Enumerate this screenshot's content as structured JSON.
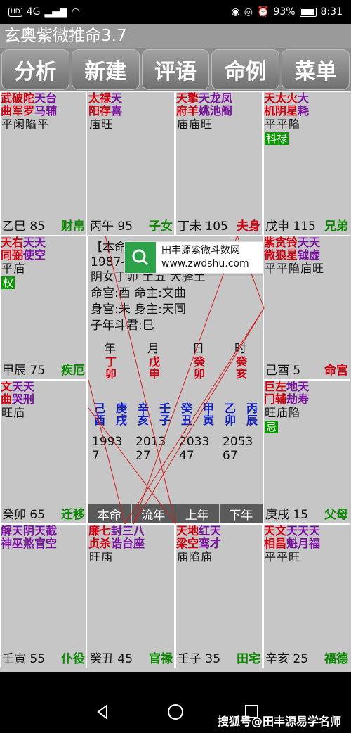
{
  "status_bar": {
    "hd": "HD",
    "signal": "4G",
    "battery": "93%",
    "time": "8:31"
  },
  "app_title": "玄奥紫微推命3.7",
  "toolbar": [
    "分析",
    "新建",
    "评语",
    "命例",
    "菜单"
  ],
  "cells": [
    {
      "cols": [
        [
          "武",
          "曲",
          "r"
        ],
        [
          "破",
          "军",
          "r"
        ],
        [
          "陀",
          "罗",
          "r"
        ],
        [
          "天",
          "马",
          "p"
        ],
        [
          "台",
          "辅",
          "p"
        ]
      ],
      "brights": "平闲陷平",
      "hua": "",
      "stem": "乙巳",
      "age": "85",
      "palace": "财帛",
      "pc": "g"
    },
    {
      "cols": [
        [
          "太",
          "阳",
          "r"
        ],
        [
          "禄",
          "存",
          "r"
        ],
        [
          "天",
          "喜",
          "p"
        ]
      ],
      "brights": "庙旺",
      "hua": "",
      "stem": "丙午",
      "age": "95",
      "palace": "子女",
      "pc": "g"
    },
    {
      "cols": [
        [
          "天",
          "府",
          "r"
        ],
        [
          "擎",
          "羊",
          "r"
        ],
        [
          "天",
          "姚",
          "p"
        ],
        [
          "龙",
          "池",
          "p"
        ],
        [
          "凤",
          "阁",
          "p"
        ]
      ],
      "brights": "庙庙旺",
      "hua": "",
      "stem": "丁未",
      "age": "105",
      "palace": "夫身",
      "pc": "r"
    },
    {
      "cols": [
        [
          "天",
          "机",
          "r"
        ],
        [
          "太",
          "阴",
          "r"
        ],
        [
          "火",
          "星",
          "r"
        ],
        [
          "大",
          "耗",
          "p"
        ]
      ],
      "brights": "平平陷",
      "hua": "科禄",
      "stem": "戊申",
      "age": "115",
      "palace": "兄弟",
      "pc": "g"
    },
    {
      "cols": [
        [
          "天",
          "同",
          "r"
        ],
        [
          "右",
          "弼",
          "r"
        ],
        [
          "天",
          "使",
          "p"
        ],
        [
          "天",
          "空",
          "p"
        ]
      ],
      "brights": "平庙",
      "hua": "权",
      "stem": "甲辰",
      "age": "75",
      "palace": "疾厄",
      "pc": "g"
    },
    {
      "cols": [
        [
          "紫",
          "微",
          "r"
        ],
        [
          "贪",
          "狼",
          "r"
        ],
        [
          "铃",
          "星",
          "r"
        ],
        [
          "天",
          "钺",
          "p"
        ],
        [
          "天",
          "虚",
          "p"
        ]
      ],
      "brights": "平平陷庙旺",
      "hua": "",
      "stem": "己酉",
      "age": "5",
      "palace": "命宫",
      "pc": "r"
    },
    {
      "cols": [
        [
          "文",
          "曲",
          "r"
        ],
        [
          "天",
          "哭",
          "p"
        ],
        [
          "天",
          "刑",
          "p"
        ]
      ],
      "brights": "旺庙",
      "hua": "",
      "stem": "癸卯",
      "age": "65",
      "palace": "迁移",
      "pc": "g"
    },
    {
      "cols": [
        [
          "巨",
          "门",
          "r"
        ],
        [
          "左",
          "辅",
          "r"
        ],
        [
          "地",
          "劫",
          "p"
        ],
        [
          "天",
          "寿",
          "p"
        ]
      ],
      "brights": "旺庙陷",
      "hua": "忌",
      "stem": "庚戌",
      "age": "15",
      "palace": "父母",
      "pc": "g"
    },
    {
      "cols": [
        [
          "解",
          "神",
          "p"
        ],
        [
          "天",
          "巫",
          "p"
        ],
        [
          "阴",
          "煞",
          "p"
        ],
        [
          "天",
          "官",
          "p"
        ],
        [
          "截",
          "空",
          "p"
        ]
      ],
      "brights": "",
      "hua": "",
      "stem": "壬寅",
      "age": "55",
      "palace": "仆役",
      "pc": "g"
    },
    {
      "cols": [
        [
          "廉",
          "贞",
          "r"
        ],
        [
          "七",
          "杀",
          "r"
        ],
        [
          "封",
          "诰",
          "p"
        ],
        [
          "三",
          "台",
          "p"
        ],
        [
          "八",
          "座",
          "p"
        ]
      ],
      "brights": "旺庙",
      "hua": "",
      "stem": "癸丑",
      "age": "45",
      "palace": "官禄",
      "pc": "g"
    },
    {
      "cols": [
        [
          "天",
          "梁",
          "r"
        ],
        [
          "地",
          "空",
          "r"
        ],
        [
          "红",
          "鸾",
          "p"
        ],
        [
          "天",
          "才",
          "p"
        ]
      ],
      "brights": "庙陷庙",
      "hua": "",
      "stem": "壬子",
      "age": "35",
      "palace": "田宅",
      "pc": "g"
    },
    {
      "cols": [
        [
          "天",
          "相",
          "r"
        ],
        [
          "文",
          "昌",
          "r"
        ],
        [
          "天",
          "魁",
          "p"
        ],
        [
          "天",
          "月",
          "p"
        ],
        [
          "天",
          "福",
          "p"
        ]
      ],
      "brights": "平平旺",
      "hua": "",
      "stem": "辛亥",
      "age": "25",
      "palace": "福德",
      "pc": "g"
    }
  ],
  "center": {
    "line1": "【本命】",
    "line2": "1987-",
    "line3": "阴女丁卯   土五   大驿土",
    "line4": "命宫:酉    命主:文曲",
    "line5": "身宫:未    身主:天同",
    "line6": "子年斗君:巳",
    "pillar_headers": [
      "年",
      "月",
      "日",
      "时"
    ],
    "pillars": [
      [
        "丁",
        "卯"
      ],
      [
        "戊",
        "申"
      ],
      [
        "癸",
        "卯"
      ],
      [
        "癸",
        "亥"
      ]
    ],
    "dayun": [
      [
        "己",
        "酉"
      ],
      [
        "庚",
        "戌"
      ],
      [
        "辛",
        "亥"
      ],
      [
        "壬",
        "子"
      ],
      [
        "癸",
        "丑"
      ],
      [
        "甲",
        "寅"
      ],
      [
        "乙",
        "卯"
      ],
      [
        "丙",
        "辰"
      ]
    ],
    "years": [
      "1993",
      "2013",
      "2033",
      "2053"
    ],
    "ages": [
      "7",
      "27",
      "47",
      "67"
    ],
    "tabs": [
      "本命",
      "流年",
      "上年",
      "下年"
    ]
  },
  "popup": {
    "title": "田丰源紫微斗数网",
    "url": "www.zwdshu.com"
  },
  "watermark": "搜狐号@田丰源易学名师"
}
